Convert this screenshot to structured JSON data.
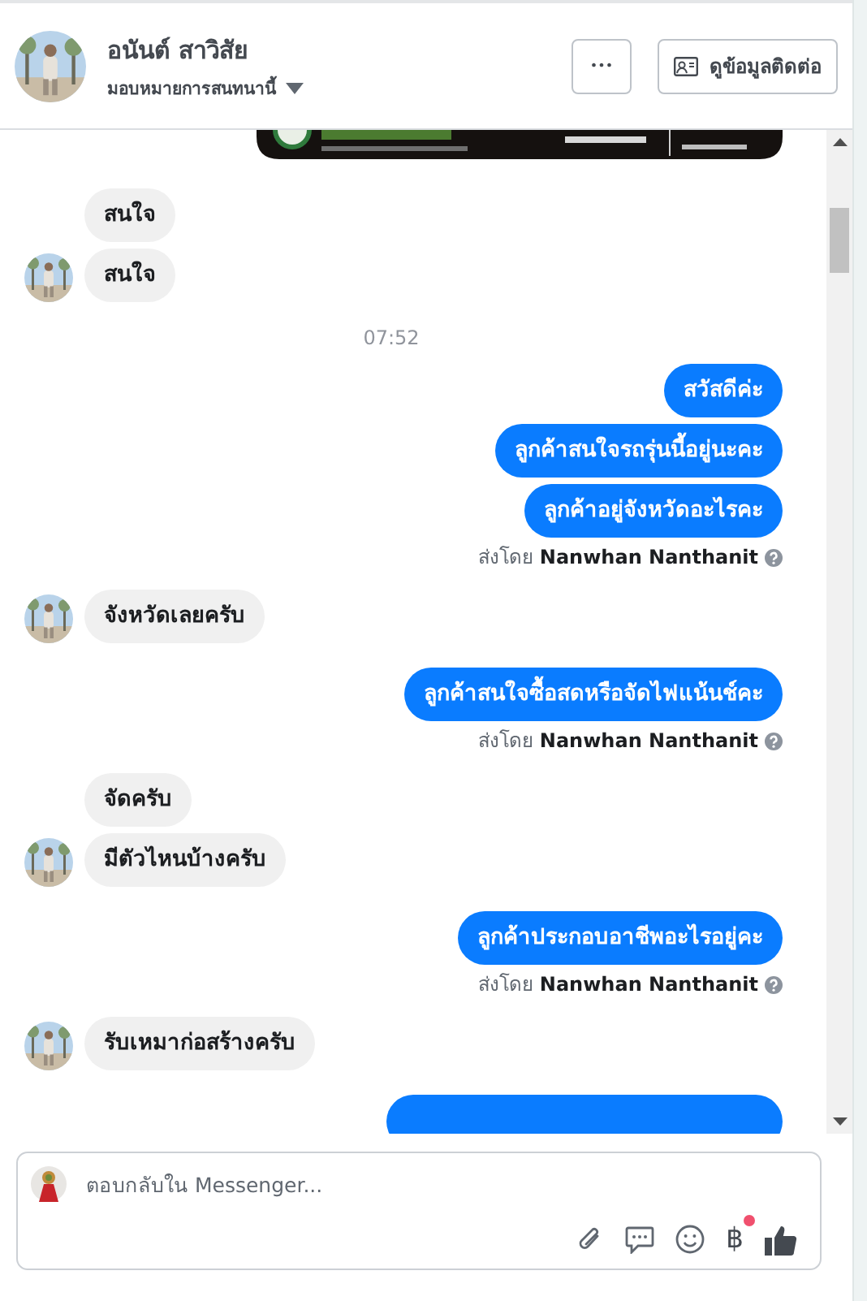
{
  "header": {
    "name": "อนันต์ สาวิสัย",
    "assign": "มอบหมายการสนทนานี้",
    "more": "•••",
    "contact": "ดูข้อมูลติดต่อ"
  },
  "messages": [
    {
      "kind": "picture"
    },
    {
      "kind": "in",
      "text": "สนใจ",
      "avatar": false
    },
    {
      "kind": "in",
      "text": "สนใจ",
      "avatar": true
    },
    {
      "kind": "time",
      "text": "07:52"
    },
    {
      "kind": "out",
      "text": "สวัสดีค่ะ"
    },
    {
      "kind": "out",
      "text": "ลูกค้าสนใจรถรุ่นนี้อยู่นะคะ"
    },
    {
      "kind": "out",
      "text": "ลูกค้าอยู่จังหวัดอะไรคะ"
    },
    {
      "kind": "sent",
      "prefix": "ส่งโดย",
      "name": "Nanwhan Nanthanit"
    },
    {
      "kind": "in",
      "text": "จังหวัดเลยครับ",
      "avatar": true
    },
    {
      "kind": "out",
      "text": "ลูกค้าสนใจซื้อสดหรือจัดไฟแน้นช์คะ"
    },
    {
      "kind": "sent",
      "prefix": "ส่งโดย",
      "name": "Nanwhan Nanthanit"
    },
    {
      "kind": "in",
      "text": "จัดครับ",
      "avatar": false
    },
    {
      "kind": "in",
      "text": "มีตัวไหนบ้างครับ",
      "avatar": true
    },
    {
      "kind": "out",
      "text": "ลูกค้าประกอบอาชีพอะไรอยู่คะ"
    },
    {
      "kind": "sent",
      "prefix": "ส่งโดย",
      "name": "Nanwhan Nanthanit"
    },
    {
      "kind": "in",
      "text": "รับเหมาก่อสร้างครับ",
      "avatar": true
    },
    {
      "kind": "cut"
    }
  ],
  "composer": {
    "placeholder": "ตอบกลับใน Messenger...",
    "currency": "฿",
    "currency_badge": true
  }
}
